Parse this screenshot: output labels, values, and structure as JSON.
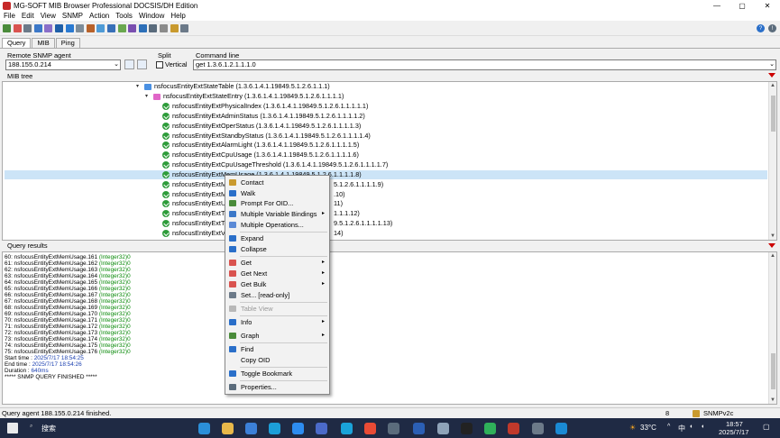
{
  "window": {
    "title": "MG-SOFT MIB Browser Professional DOCSIS/DH Edition",
    "controls": [
      "—",
      "▢",
      "✕"
    ]
  },
  "menu": [
    "File",
    "Edit",
    "View",
    "SNMP",
    "Action",
    "Tools",
    "Window",
    "Help"
  ],
  "tabs": [
    "Query",
    "MIB",
    "Ping"
  ],
  "agent": {
    "label": "Remote SNMP agent",
    "value": "188.155.0.214"
  },
  "split": {
    "label": "Split",
    "checkbox": "Vertical"
  },
  "command": {
    "label": "Command line",
    "value": "get 1.3.6.1.2.1.1.1.0"
  },
  "mib_tree_label": "MIB tree",
  "tree": [
    {
      "label": "nsfocusEntityExtStateTable (1.3.6.1.4.1.19849.5.1.2.6.1.1.1)",
      "kind": "table"
    },
    {
      "label": "nsfocusEntityExtStateEntry (1.3.6.1.4.1.19849.5.1.2.6.1.1.1.1)",
      "kind": "entry"
    },
    {
      "label": "nsfocusEntityExtPhysicalIndex (1.3.6.1.4.1.19849.5.1.2.6.1.1.1.1.1)",
      "kind": "leaf"
    },
    {
      "label": "nsfocusEntityExtAdminStatus (1.3.6.1.4.1.19849.5.1.2.6.1.1.1.1.2)",
      "kind": "leaf"
    },
    {
      "label": "nsfocusEntityExtOperStatus (1.3.6.1.4.1.19849.5.1.2.6.1.1.1.1.3)",
      "kind": "leaf"
    },
    {
      "label": "nsfocusEntityExtStandbyStatus (1.3.6.1.4.1.19849.5.1.2.6.1.1.1.1.4)",
      "kind": "leaf"
    },
    {
      "label": "nsfocusEntityExtAlarmLight (1.3.6.1.4.1.19849.5.1.2.6.1.1.1.1.5)",
      "kind": "leaf"
    },
    {
      "label": "nsfocusEntityExtCpuUsage (1.3.6.1.4.1.19849.5.1.2.6.1.1.1.1.6)",
      "kind": "leaf"
    },
    {
      "label": "nsfocusEntityExtCpuUsageThreshold (1.3.6.1.4.1.19849.5.1.2.6.1.1.1.1.7)",
      "kind": "leaf"
    },
    {
      "label": "nsfocusEntityExtMemUsage (1.3.6.1.4.1.19849.5.1.2.6.1.1.1.1.8)",
      "kind": "leaf",
      "selected": true
    },
    {
      "label": "nsfocusEntityExtM",
      "tail": "5.1.2.6.1.1.1.1.9)",
      "kind": "leaf"
    },
    {
      "label": "nsfocusEntityExtM",
      "tail": ".10)",
      "kind": "leaf"
    },
    {
      "label": "nsfocusEntityExtUp",
      "tail": "11)",
      "kind": "leaf"
    },
    {
      "label": "nsfocusEntityExtTe",
      "tail": "1.1.1.12)",
      "kind": "leaf"
    },
    {
      "label": "nsfocusEntityExtTe",
      "tail": "9.5.1.2.6.1.1.1.1.13)",
      "kind": "leaf"
    },
    {
      "label": "nsfocusEntityExtVo",
      "tail": "14)",
      "kind": "leaf"
    }
  ],
  "query_results_label": "Query results",
  "results": [
    {
      "n": "60:",
      "name": "nsfocusEntityExtMemUsage.161",
      "type": "(Integer32)",
      "val": "0"
    },
    {
      "n": "61:",
      "name": "nsfocusEntityExtMemUsage.162",
      "type": "(Integer32)",
      "val": "0"
    },
    {
      "n": "62:",
      "name": "nsfocusEntityExtMemUsage.163",
      "type": "(Integer32)",
      "val": "0"
    },
    {
      "n": "63:",
      "name": "nsfocusEntityExtMemUsage.164",
      "type": "(Integer32)",
      "val": "0"
    },
    {
      "n": "64:",
      "name": "nsfocusEntityExtMemUsage.165",
      "type": "(Integer32)",
      "val": "0"
    },
    {
      "n": "65:",
      "name": "nsfocusEntityExtMemUsage.166",
      "type": "(Integer32)",
      "val": "0"
    },
    {
      "n": "66:",
      "name": "nsfocusEntityExtMemUsage.167",
      "type": "(Integer32)",
      "val": "0"
    },
    {
      "n": "67:",
      "name": "nsfocusEntityExtMemUsage.168",
      "type": "(Integer32)",
      "val": "0"
    },
    {
      "n": "68:",
      "name": "nsfocusEntityExtMemUsage.169",
      "type": "(Integer32)",
      "val": "0"
    },
    {
      "n": "69:",
      "name": "nsfocusEntityExtMemUsage.170",
      "type": "(Integer32)",
      "val": "0"
    },
    {
      "n": "70:",
      "name": "nsfocusEntityExtMemUsage.171",
      "type": "(Integer32)",
      "val": "0"
    },
    {
      "n": "71:",
      "name": "nsfocusEntityExtMemUsage.172",
      "type": "(Integer32)",
      "val": "0"
    },
    {
      "n": "72:",
      "name": "nsfocusEntityExtMemUsage.173",
      "type": "(Integer32)",
      "val": "0"
    },
    {
      "n": "73:",
      "name": "nsfocusEntityExtMemUsage.174",
      "type": "(Integer32)",
      "val": "0"
    },
    {
      "n": "74:",
      "name": "nsfocusEntityExtMemUsage.175",
      "type": "(Integer32)",
      "val": "0"
    },
    {
      "n": "75:",
      "name": "nsfocusEntityExtMemUsage.176",
      "type": "(Integer32)",
      "val": "0"
    }
  ],
  "summary": {
    "start_label": "Start time :",
    "start": "2025/7/17 18:54:25",
    "end_label": "End time :",
    "end": "2025/7/17 18:54:26",
    "dur_label": "Duration :",
    "dur": "640ms",
    "finished": "***** SNMP QUERY FINISHED *****"
  },
  "context_menu": [
    {
      "label": "Contact",
      "icon": "contact-icon"
    },
    {
      "label": "Walk",
      "icon": "walk-icon"
    },
    {
      "label": "Prompt For OID...",
      "icon": "prompt-icon"
    },
    {
      "label": "Multiple Variable Bindings",
      "icon": "varbind-icon",
      "sub": true
    },
    {
      "label": "Multiple Operations...",
      "icon": "ops-icon",
      "sep_after": true
    },
    {
      "label": "Expand",
      "icon": "expand-icon"
    },
    {
      "label": "Collapse",
      "icon": "collapse-icon",
      "sep_after": true
    },
    {
      "label": "Get",
      "icon": "get-icon",
      "sub": true
    },
    {
      "label": "Get Next",
      "icon": "get-next-icon",
      "sub": true
    },
    {
      "label": "Get Bulk",
      "icon": "get-bulk-icon",
      "sub": true
    },
    {
      "label": "Set...  [read-only]",
      "icon": "set-icon",
      "sep_after": true
    },
    {
      "label": "Table View",
      "icon": "table-view-icon",
      "disabled": true,
      "sep_after": true
    },
    {
      "label": "Info",
      "icon": "info-icon",
      "sub": true
    },
    {
      "label": "Graph",
      "icon": "graph-icon",
      "sub": true,
      "sep_after": true
    },
    {
      "label": "Find",
      "icon": "find-icon"
    },
    {
      "label": "Copy OID",
      "icon": "copy-oid-icon",
      "sep_after": true
    },
    {
      "label": "Toggle Bookmark",
      "icon": "bookmark-icon",
      "sep_after": true
    },
    {
      "label": "Properties...",
      "icon": "properties-icon"
    }
  ],
  "status": {
    "text": "Query agent 188.155.0.214 finished.",
    "count": "8",
    "version": "SNMPv2c"
  },
  "taskbar": {
    "search": "搜索",
    "weather": "33°C",
    "ime": "中",
    "time": "18:57",
    "date": "2025/7/17"
  }
}
